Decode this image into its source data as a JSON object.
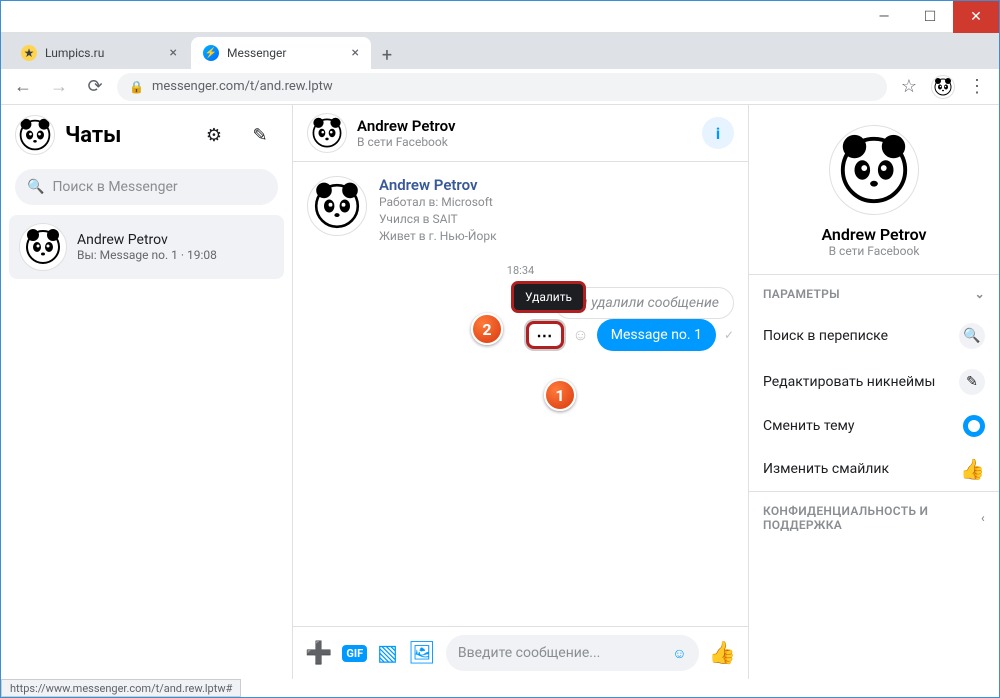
{
  "window": {
    "min": "—",
    "max": "☐",
    "close": "✕"
  },
  "tabs": {
    "t1": {
      "label": "Lumpics.ru"
    },
    "t2": {
      "label": "Messenger"
    }
  },
  "addr": {
    "url": "messenger.com/t/and.rew.lptw"
  },
  "sidebar": {
    "title": "Чаты",
    "search_placeholder": "Поиск в Messenger",
    "chat_name": "Andrew Petrov",
    "chat_preview": "Вы: Message no. 1 · 19:08"
  },
  "conv": {
    "title": "Andrew Petrov",
    "subtitle": "В сети Facebook",
    "intro_name": "Andrew Petrov",
    "intro_l1": "Работал в: Microsoft",
    "intro_l2": "Учился в SAIT",
    "intro_l3": "Живет в г. Нью-Йорк",
    "time": "18:34",
    "deleted": "Вы удалили сообщение",
    "tooltip": "Удалить",
    "msg": "Message no. 1"
  },
  "composer": {
    "placeholder": "Введите сообщение..."
  },
  "right": {
    "name": "Andrew Petrov",
    "status": "В сети Facebook",
    "params_title": "ПАРАМЕТРЫ",
    "r1": "Поиск в переписке",
    "r2": "Редактировать никнеймы",
    "r3": "Сменить тему",
    "r4": "Изменить смайлик",
    "privacy_title": "КОНФИДЕНЦИАЛЬНОСТЬ И ПОДДЕРЖКА"
  },
  "statusbar": "https://www.messenger.com/t/and.rew.lptw#",
  "badges": {
    "one": "1",
    "two": "2"
  },
  "gif": "GIF"
}
